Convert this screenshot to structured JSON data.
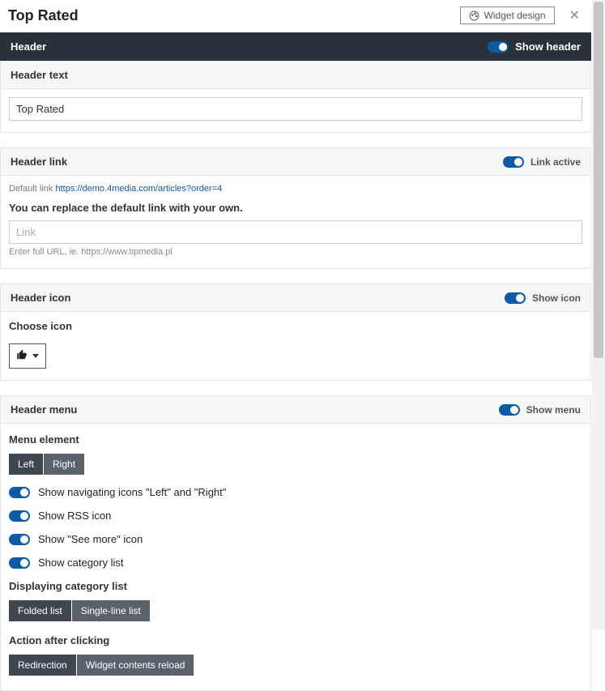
{
  "title": "Top Rated",
  "widget_design_label": "Widget design",
  "header": {
    "section_label": "Header",
    "show_header_label": "Show header"
  },
  "header_text": {
    "section_label": "Header text",
    "value": "Top Rated"
  },
  "header_link": {
    "section_label": "Header link",
    "link_active_label": "Link active",
    "default_link_prefix": "Default link ",
    "default_link_url": "https://demo.4media.com/articles?order=4",
    "replace_label": "You can replace the default link with your own.",
    "placeholder": "Link",
    "hint": "Enter full URL, ie. https://www.tipmedia.pl"
  },
  "header_icon": {
    "section_label": "Header icon",
    "show_icon_label": "Show icon",
    "choose_label": "Choose icon"
  },
  "header_menu": {
    "section_label": "Header menu",
    "show_menu_label": "Show menu",
    "menu_element_label": "Menu element",
    "position_options": [
      "Left",
      "Right"
    ],
    "nav_icons_label": "Show navigating icons \"Left\" and \"Right\"",
    "rss_label": "Show RSS icon",
    "see_more_label": "Show \"See more\" icon",
    "category_list_label": "Show category list",
    "displaying_label": "Displaying category list",
    "displaying_options": [
      "Folded list",
      "Single-line list"
    ],
    "action_label": "Action after clicking",
    "action_options": [
      "Redirection",
      "Widget contents reload"
    ]
  }
}
